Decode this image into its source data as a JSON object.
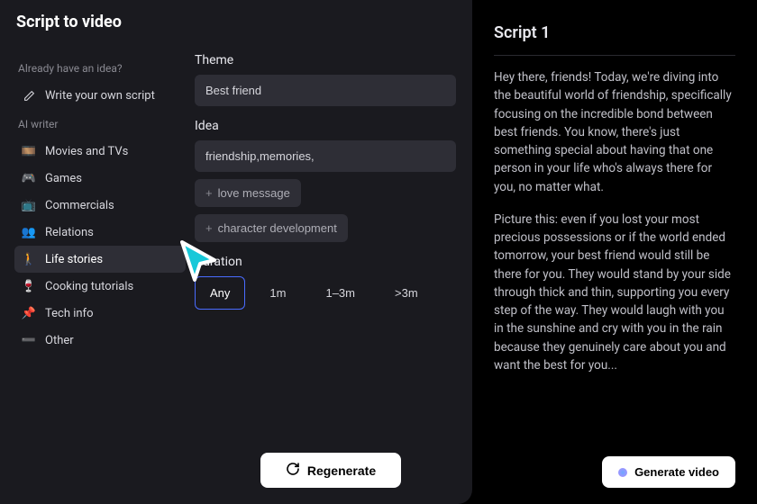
{
  "header": {
    "title": "Script to video"
  },
  "sidebar": {
    "section1_label": "Already have an idea?",
    "write_own": "Write your own script",
    "section2_label": "AI writer",
    "items": [
      {
        "icon": "🎞️",
        "label": "Movies and TVs"
      },
      {
        "icon": "🎮",
        "label": "Games"
      },
      {
        "icon": "📺",
        "label": "Commercials"
      },
      {
        "icon": "👥",
        "label": "Relations"
      },
      {
        "icon": "🚶",
        "label": "Life stories"
      },
      {
        "icon": "🍷",
        "label": "Cooking tutorials"
      },
      {
        "icon": "📌",
        "label": "Tech info"
      },
      {
        "icon": "➖",
        "label": "Other"
      }
    ]
  },
  "form": {
    "theme_label": "Theme",
    "theme_value": "Best friend",
    "idea_label": "Idea",
    "idea_value": "friendship,memories,",
    "idea_chips": [
      "love message",
      "character development"
    ],
    "duration_label": "Duration",
    "durations": [
      "Any",
      "1m",
      "1–3m",
      ">3m"
    ],
    "regenerate_label": "Regenerate"
  },
  "script": {
    "title": "Script 1",
    "para1": "Hey there, friends! Today, we're diving into the beautiful world of friendship, specifically focusing on the incredible bond between best friends. You know, there's just something special about having that one person in your life who's always there for you, no matter what.",
    "para2": "Picture this: even if you lost your most precious possessions or if the world ended tomorrow, your best friend would still be there for you. They would stand by your side through thick and thin, supporting you every step of the way. They would laugh with you in the sunshine and cry with you in the rain because they genuinely care about you and want the best for you...",
    "generate_label": "Generate video"
  }
}
